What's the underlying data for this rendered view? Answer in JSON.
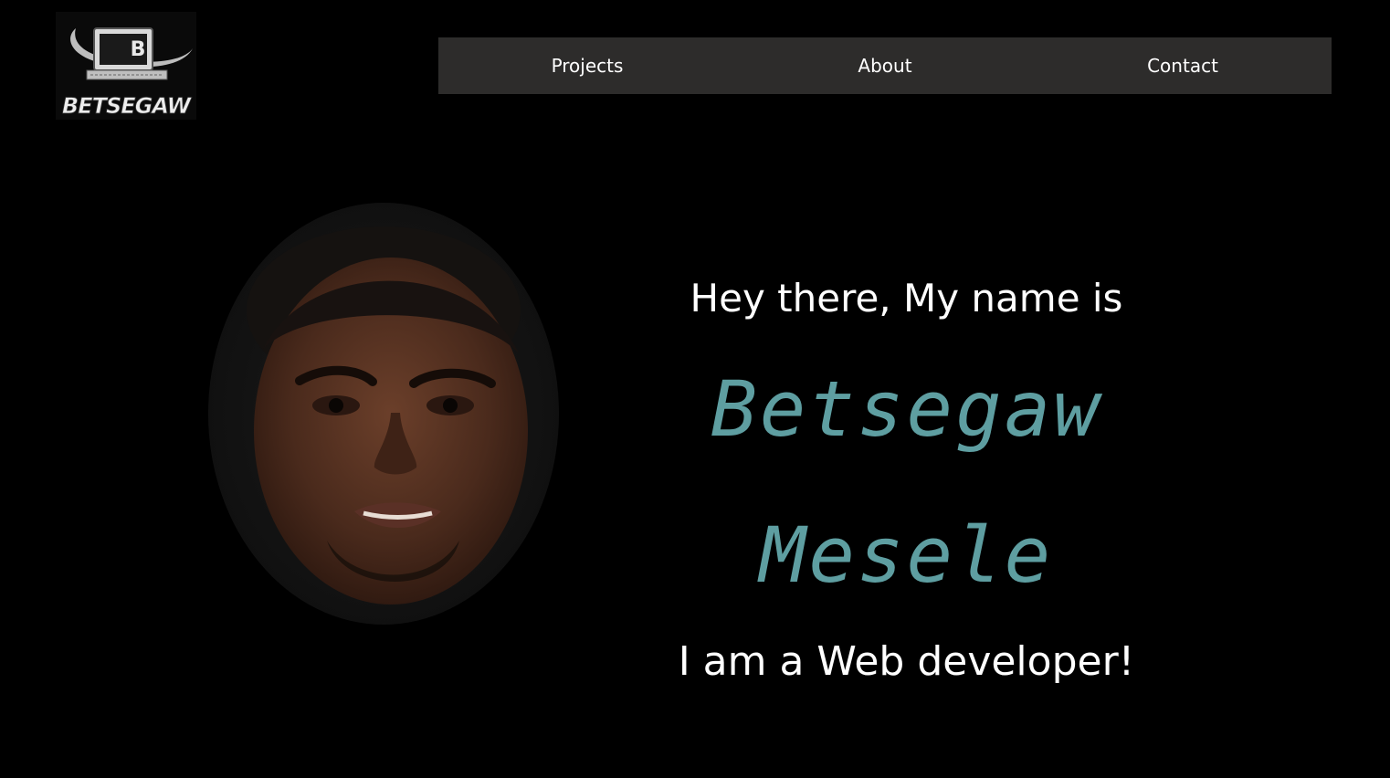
{
  "brand": {
    "logo_text": "BETSEGAW",
    "logo_monogram": "B",
    "logo_icon": "computer-monitor-icon"
  },
  "nav": {
    "items": [
      {
        "label": "Projects"
      },
      {
        "label": "About"
      },
      {
        "label": "Contact"
      }
    ]
  },
  "hero": {
    "greeting": "Hey there, My name is",
    "name": "Betsegaw Mesele",
    "role": "I am a Web developer!",
    "portrait": "profile-photo"
  },
  "colors": {
    "background": "#000000",
    "nav_background": "#2d2c2b",
    "accent": "#5e9ea1",
    "text": "#ffffff"
  }
}
